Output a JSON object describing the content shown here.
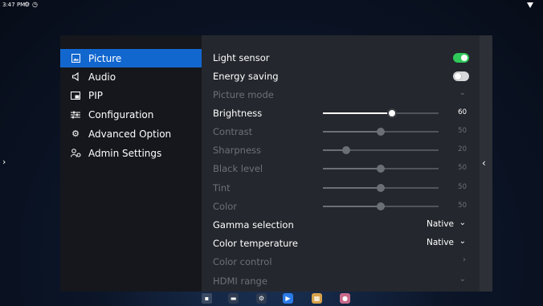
{
  "status_bar": {
    "time": "3:47 PM",
    "icons": [
      "settings-gear-icon",
      "clock-icon",
      "wifi-icon"
    ]
  },
  "menu": {
    "items": [
      {
        "label": "Picture",
        "icon": "picture-icon",
        "active": true
      },
      {
        "label": "Audio",
        "icon": "speaker-icon",
        "active": false
      },
      {
        "label": "PIP",
        "icon": "pip-icon",
        "active": false
      },
      {
        "label": "Configuration",
        "icon": "sliders-icon",
        "active": false
      },
      {
        "label": "Advanced Option",
        "icon": "gear-icon",
        "active": false
      },
      {
        "label": "Admin Settings",
        "icon": "admin-icon",
        "active": false
      }
    ]
  },
  "settings": {
    "light_sensor": {
      "label": "Light sensor",
      "enabled": true
    },
    "energy_saving": {
      "label": "Energy saving",
      "enabled": false
    },
    "picture_mode": {
      "label": "Picture mode"
    },
    "brightness": {
      "label": "Brightness",
      "value": "60",
      "level": 0.6
    },
    "contrast": {
      "label": "Contrast",
      "value": "50",
      "level": 0.5
    },
    "sharpness": {
      "label": "Sharpness",
      "value": "20",
      "level": 0.2
    },
    "black_level": {
      "label": "Black level",
      "value": "50",
      "level": 0.5
    },
    "tint": {
      "label": "Tint",
      "value": "50",
      "level": 0.5
    },
    "color": {
      "label": "Color",
      "value": "50",
      "level": 0.5
    },
    "gamma_selection": {
      "label": "Gamma selection",
      "value": "Native"
    },
    "color_temperature": {
      "label": "Color temperature",
      "value": "Native"
    },
    "color_control": {
      "label": "Color control"
    },
    "hdmi_range": {
      "label": "HDMI range"
    }
  },
  "colors": {
    "accent": "#1267cf",
    "toggle_on": "#2fc95a",
    "panel_bg": "#24272d",
    "menu_bg": "#15171c",
    "dim_text": "#6d7179"
  },
  "taskbar": {
    "icons": [
      "apps-icon",
      "folder-icon",
      "settings-icon",
      "media-player-icon",
      "gallery-icon",
      "record-icon"
    ]
  }
}
